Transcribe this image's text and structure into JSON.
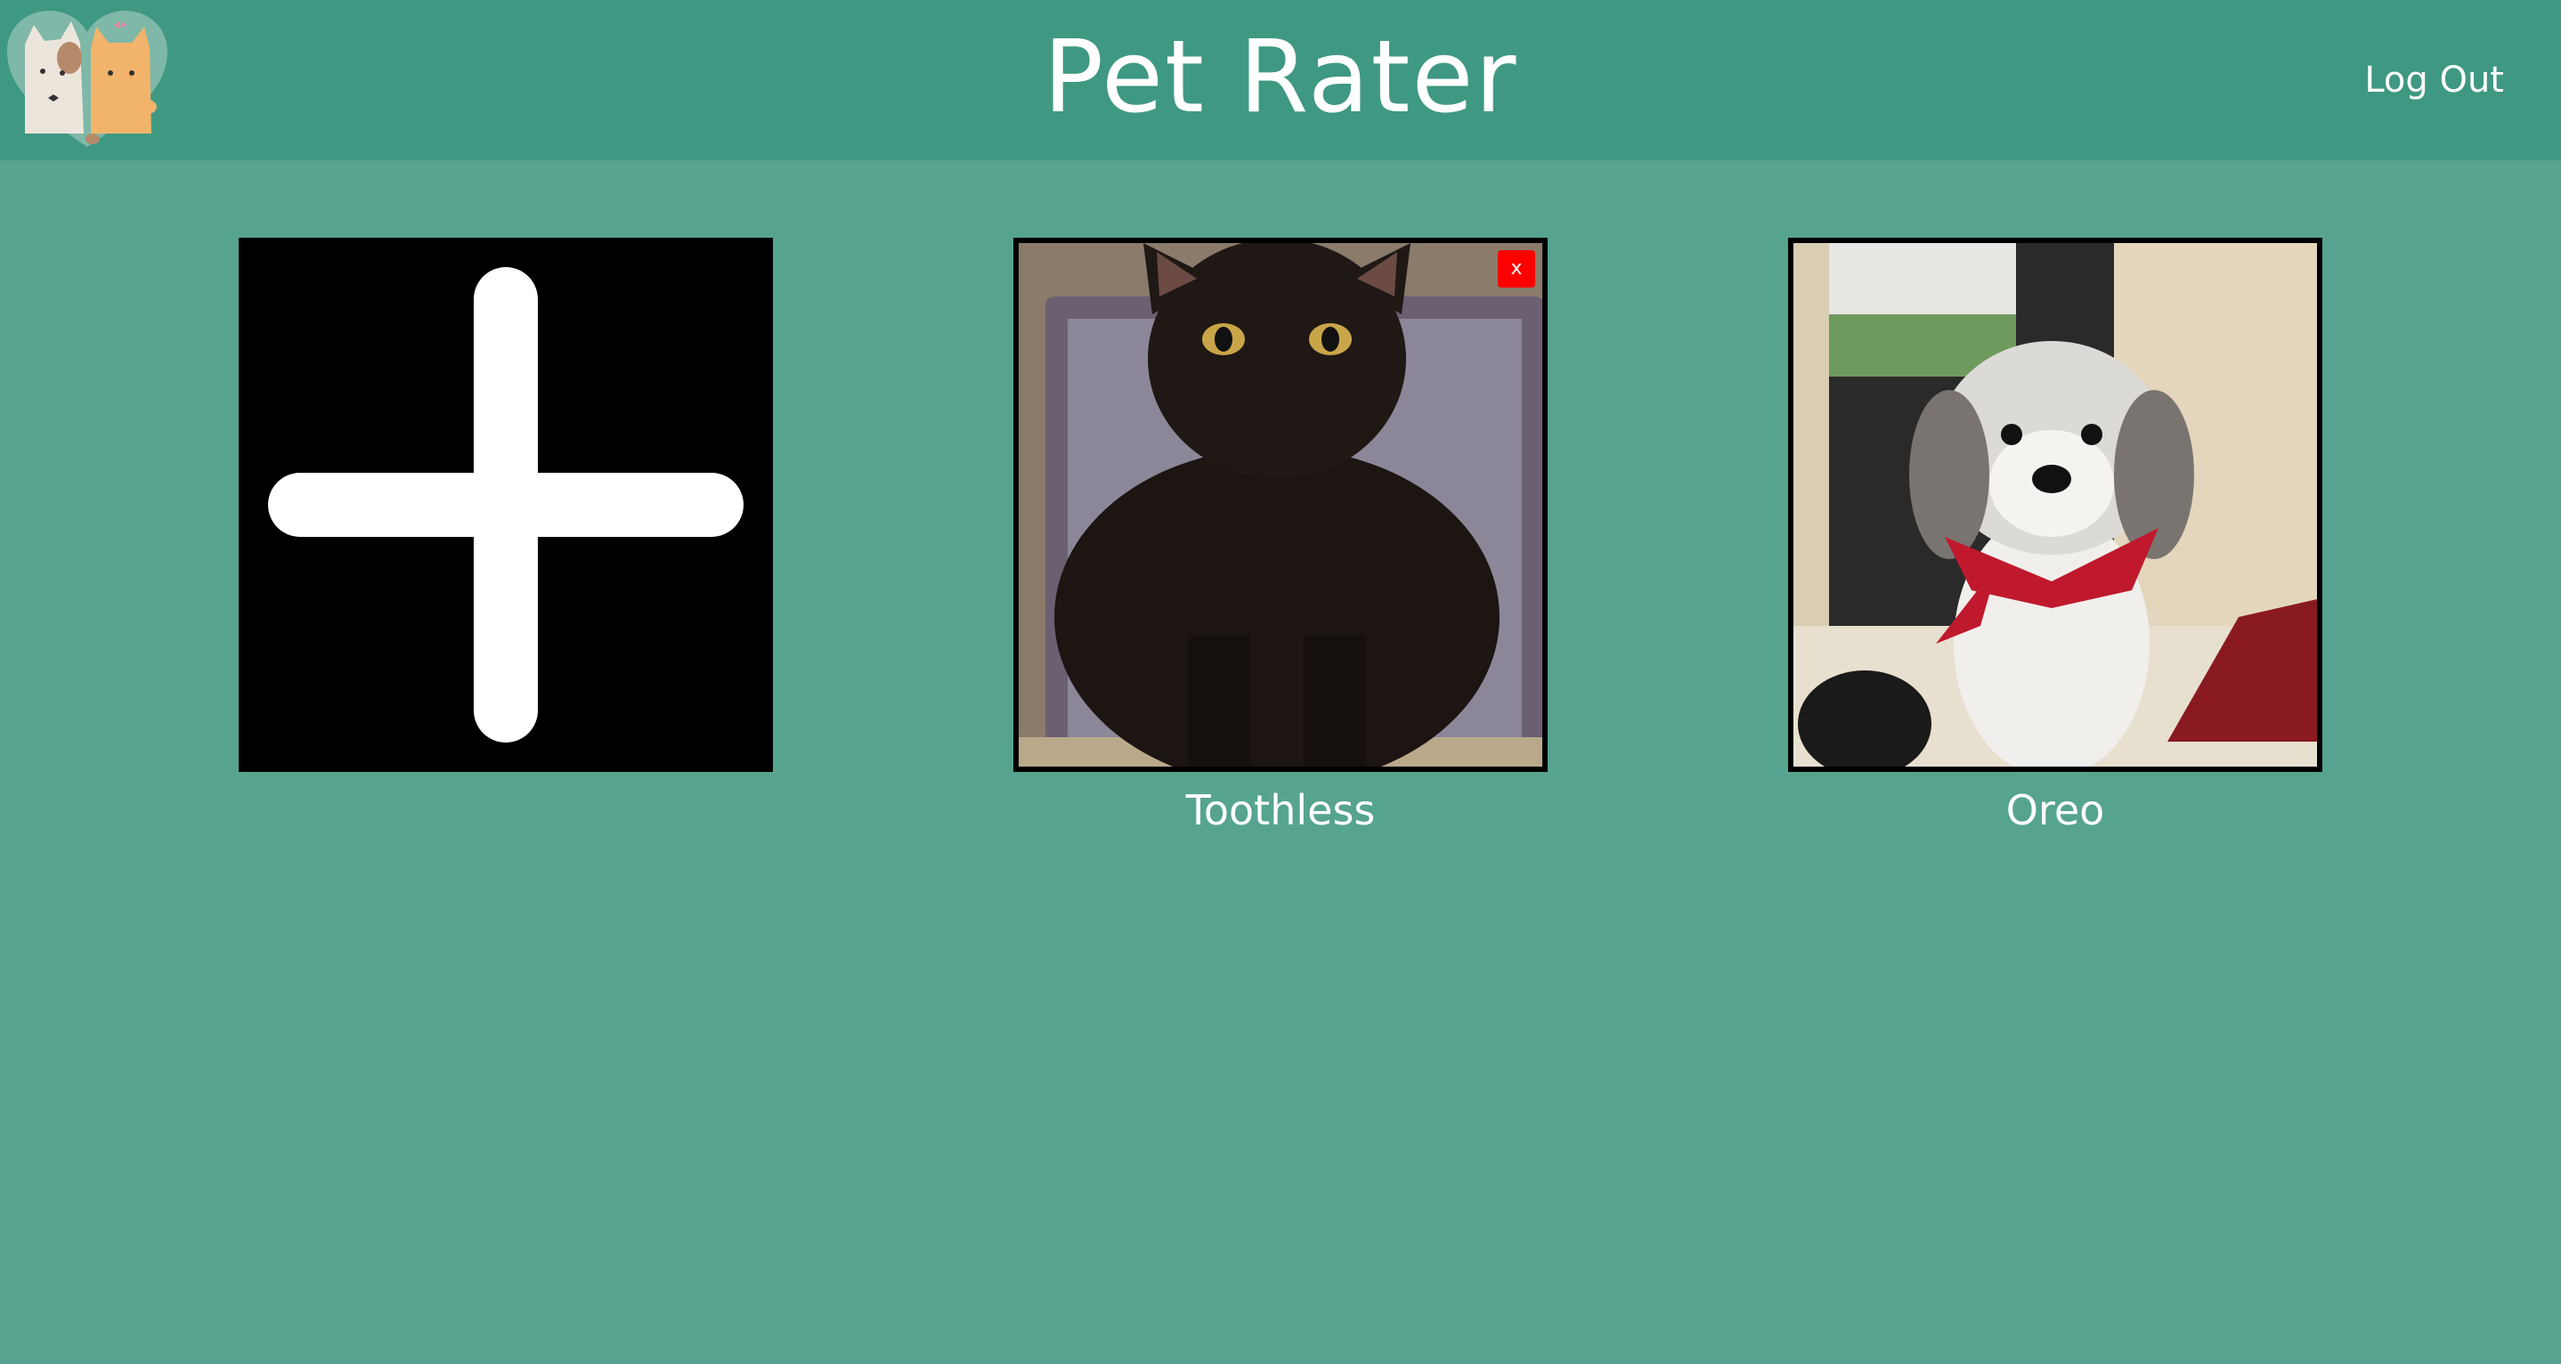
{
  "header": {
    "title": "Pet Rater",
    "logout_label": "Log Out",
    "logo_icon": "cat-dog-heart-logo"
  },
  "add_tile": {
    "icon": "plus-icon"
  },
  "pets": [
    {
      "name": "Toothless",
      "image": "black-cat-photo",
      "delete_label": "x"
    },
    {
      "name": "Oreo",
      "image": "white-dog-red-bandana-photo"
    }
  ],
  "colors": {
    "header_bg": "#3f9882",
    "page_bg": "#56a48f",
    "delete_bg": "#ff0000",
    "text": "#ffffff"
  }
}
